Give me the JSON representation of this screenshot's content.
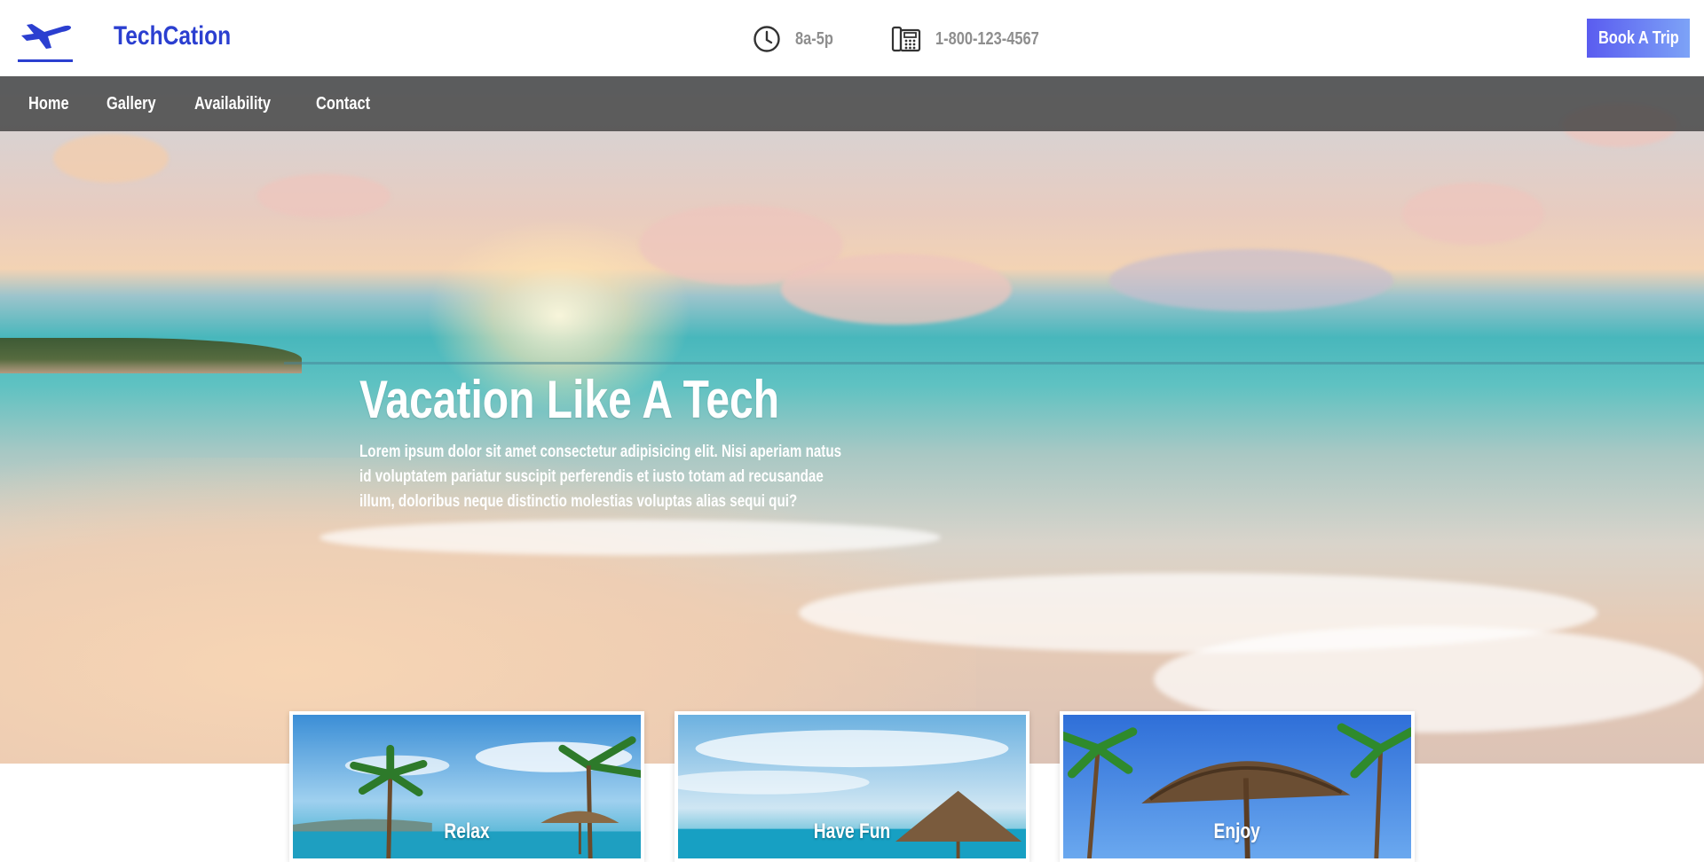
{
  "brand": {
    "name": "TechCation",
    "logo_icon": "airplane-icon",
    "color": "#2b3fd0"
  },
  "header": {
    "hours": {
      "icon": "clock-icon",
      "text": "8a-5p"
    },
    "phone": {
      "icon": "phone-icon",
      "text": "1-800-123-4567"
    },
    "cta_label": "Book A Trip"
  },
  "nav": {
    "items": [
      {
        "label": "Home"
      },
      {
        "label": "Gallery"
      },
      {
        "label": "Availability"
      },
      {
        "label": "Contact"
      }
    ]
  },
  "hero": {
    "title": "Vacation Like A Tech",
    "body": "Lorem ipsum dolor sit amet consectetur adipisicing elit. Nisi aperiam natus id voluptatem pariatur suscipit perferendis et iusto totam ad recusandae illum, doloribus neque distinctio molestias voluptas alias sequi qui?"
  },
  "cards": [
    {
      "label": "Relax"
    },
    {
      "label": "Have Fun"
    },
    {
      "label": "Enjoy"
    }
  ],
  "colors": {
    "accent": "#5a5cf0",
    "nav_bg": "#464646",
    "muted_text": "#8e8e8e"
  }
}
